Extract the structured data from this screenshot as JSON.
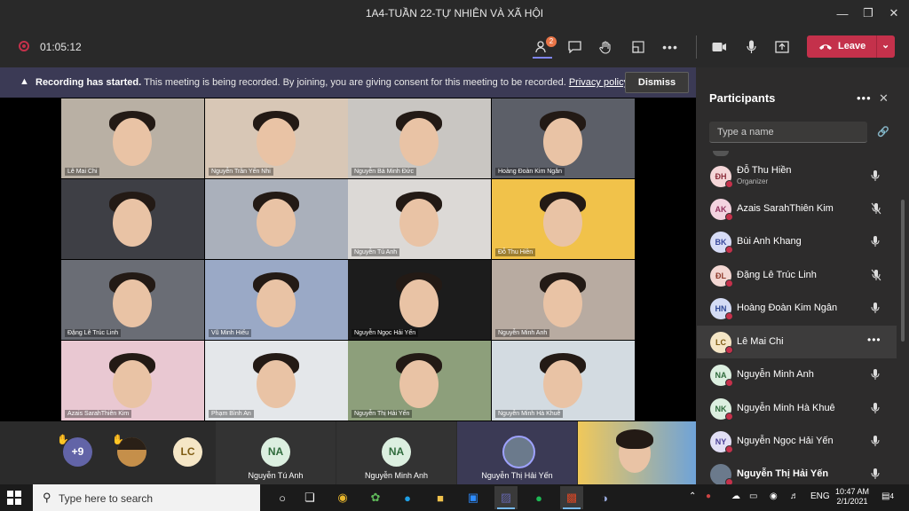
{
  "window": {
    "title": "1A4-TUẦN 22-TỰ NHIÊN VÀ XÃ HỘI",
    "min_icon": "minimize-icon",
    "max_icon": "maximize-icon",
    "close_icon": "close-icon"
  },
  "toolbar": {
    "timer": "01:05:12",
    "people_badge": "2",
    "leave_label": "Leave"
  },
  "banner": {
    "bold": "Recording has started.",
    "text": "This meeting is being recorded. By joining, you are giving consent for this meeting to be recorded.",
    "link": "Privacy policy",
    "dismiss": "Dismiss"
  },
  "video_tiles": [
    "Lê Mai Chi",
    "Nguyễn Trần Yến Nhi",
    "Nguyễn Bá Minh Đức",
    "Hoàng Đoàn Kim Ngân",
    "",
    "",
    "Nguyễn Tú Anh",
    "Đỗ Thu Hiền",
    "Đặng Lê Trúc Linh",
    "Vũ Minh Hiếu",
    "Nguyễn Ngọc Hải Yến",
    "Nguyễn Minh Anh",
    "Azais SarahThiên Kim",
    "Phạm Bình An",
    "Nguyễn Thị Hải Yến",
    "Nguyễn Minh Hà Khuê"
  ],
  "gallery": {
    "overflow": "+9",
    "lc_initials": "LC",
    "na1_initials": "NA",
    "na1_name": "Nguyễn Tú Anh",
    "na2_initials": "NA",
    "na2_name": "Nguyễn Minh Anh",
    "hy_name": "Nguyễn Thị Hải Yến"
  },
  "participants": {
    "title": "Participants",
    "search_placeholder": "Type a name",
    "list": [
      {
        "initials": "ĐH",
        "name": "Đỗ Thu Hiền",
        "role": "Organizer",
        "mic": "mic-icon",
        "color": "#f4d6d8",
        "fg": "#8b2d3a"
      },
      {
        "initials": "AK",
        "name": "Azais SarahThiên Kim",
        "mic": "mic-off-icon",
        "color": "#f3d3e0",
        "fg": "#93335f"
      },
      {
        "initials": "BK",
        "name": "Bùi Anh Khang",
        "mic": "mic-icon",
        "color": "#d7dcf6",
        "fg": "#3b4a9c"
      },
      {
        "initials": "ĐL",
        "name": "Đặng Lê Trúc Linh",
        "mic": "mic-off-icon",
        "color": "#f3d7d3",
        "fg": "#8f3b2c"
      },
      {
        "initials": "HN",
        "name": "Hoàng Đoàn Kim Ngân",
        "mic": "mic-icon",
        "color": "#d4dcf5",
        "fg": "#314a96"
      },
      {
        "initials": "LC",
        "name": "Lê Mai Chi",
        "mic": "more-icon",
        "color": "#f5e6c6",
        "fg": "#7e5b12"
      },
      {
        "initials": "NA",
        "name": "Nguyễn Minh Anh",
        "mic": "mic-icon",
        "color": "#dcefe0",
        "fg": "#2f6b3c"
      },
      {
        "initials": "NK",
        "name": "Nguyễn Minh Hà Khuê",
        "mic": "mic-icon",
        "color": "#dcefe0",
        "fg": "#2f6b3c"
      },
      {
        "initials": "NY",
        "name": "Nguyễn Ngọc Hải Yến",
        "mic": "mic-icon",
        "color": "#e2dff5",
        "fg": "#4b3f96"
      },
      {
        "initials": "",
        "name": "Nguyễn Thị Hải Yến",
        "mic": "mic-icon",
        "color": "#6b7a8c",
        "fg": "#fff"
      }
    ]
  },
  "taskbar": {
    "search_placeholder": "Type here to search",
    "lang": "ENG",
    "time": "10:47 AM",
    "date": "2/1/2021",
    "notif_count": "4"
  }
}
